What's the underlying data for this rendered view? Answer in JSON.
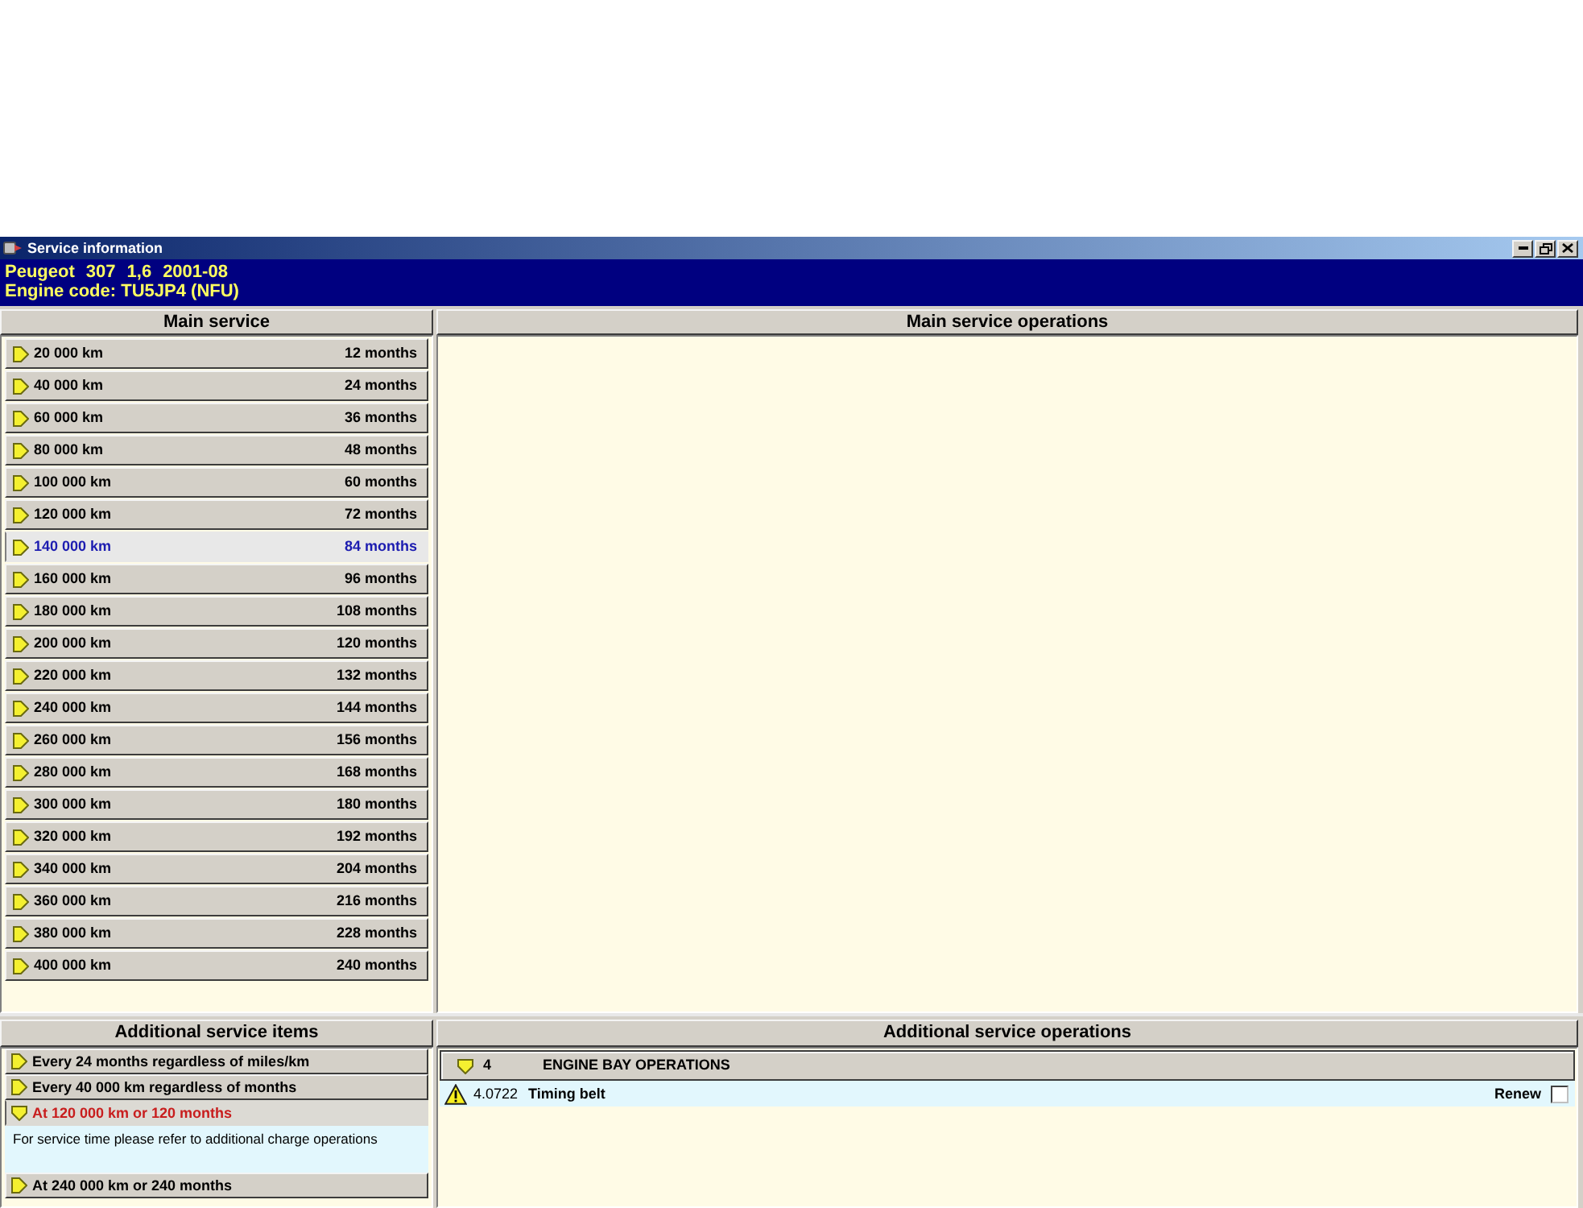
{
  "window": {
    "title": "Service information"
  },
  "vehicle": {
    "make": "Peugeot",
    "model": "307",
    "engine": "1,6",
    "date": "2001-08",
    "engine_code": "Engine code: TU5JP4 (NFU)"
  },
  "main_service": {
    "title": "Main service",
    "items": [
      {
        "distance": "20 000 km",
        "interval": "12 months",
        "selected": false
      },
      {
        "distance": "40 000 km",
        "interval": "24 months",
        "selected": false
      },
      {
        "distance": "60 000 km",
        "interval": "36 months",
        "selected": false
      },
      {
        "distance": "80 000 km",
        "interval": "48 months",
        "selected": false
      },
      {
        "distance": "100 000 km",
        "interval": "60 months",
        "selected": false
      },
      {
        "distance": "120 000 km",
        "interval": "72 months",
        "selected": false
      },
      {
        "distance": "140 000 km",
        "interval": "84 months",
        "selected": true
      },
      {
        "distance": "160 000 km",
        "interval": "96 months",
        "selected": false
      },
      {
        "distance": "180 000 km",
        "interval": "108 months",
        "selected": false
      },
      {
        "distance": "200 000 km",
        "interval": "120 months",
        "selected": false
      },
      {
        "distance": "220 000 km",
        "interval": "132 months",
        "selected": false
      },
      {
        "distance": "240 000 km",
        "interval": "144 months",
        "selected": false
      },
      {
        "distance": "260 000 km",
        "interval": "156 months",
        "selected": false
      },
      {
        "distance": "280 000 km",
        "interval": "168 months",
        "selected": false
      },
      {
        "distance": "300 000 km",
        "interval": "180 months",
        "selected": false
      },
      {
        "distance": "320 000 km",
        "interval": "192 months",
        "selected": false
      },
      {
        "distance": "340 000 km",
        "interval": "204 months",
        "selected": false
      },
      {
        "distance": "360 000 km",
        "interval": "216 months",
        "selected": false
      },
      {
        "distance": "380 000 km",
        "interval": "228 months",
        "selected": false
      },
      {
        "distance": "400 000 km",
        "interval": "240 months",
        "selected": false
      }
    ]
  },
  "main_service_operations": {
    "title": "Main service operations"
  },
  "additional_service_items": {
    "title": "Additional service items",
    "items": [
      {
        "label": "Every 24 months regardless of miles/km",
        "expanded": false
      },
      {
        "label": "Every 40 000 km regardless of months",
        "expanded": false
      },
      {
        "label": "At 120 000 km or 120 months",
        "expanded": true,
        "note": "For service time please refer to additional charge operations"
      },
      {
        "label": "At 240 000 km or 240 months",
        "expanded": false
      }
    ]
  },
  "additional_service_operations": {
    "title": "Additional service operations",
    "groups": [
      {
        "code": "4",
        "label": "ENGINE BAY OPERATIONS",
        "expanded": true,
        "operations": [
          {
            "code": "4.0722",
            "label": "Timing belt",
            "action": "Renew",
            "warning": true,
            "checked": false
          }
        ]
      }
    ]
  }
}
